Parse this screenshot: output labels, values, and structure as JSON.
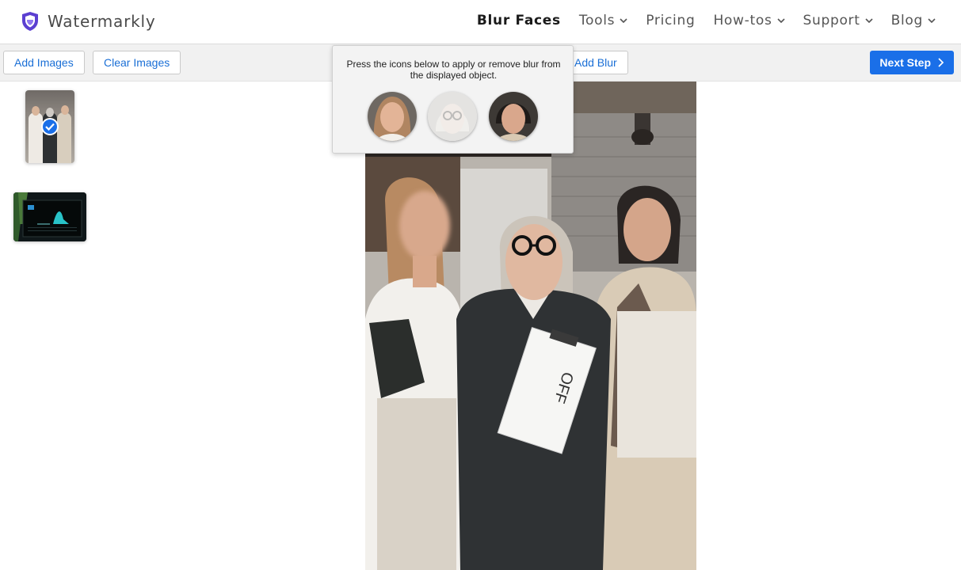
{
  "brand": {
    "name": "Watermarkly",
    "logo_icon": "shield-icon",
    "accent": "#5b3fd1"
  },
  "nav": [
    {
      "label": "Blur Faces",
      "active": true,
      "has_dropdown": false
    },
    {
      "label": "Tools",
      "active": false,
      "has_dropdown": true
    },
    {
      "label": "Pricing",
      "active": false,
      "has_dropdown": false
    },
    {
      "label": "How-tos",
      "active": false,
      "has_dropdown": true
    },
    {
      "label": "Support",
      "active": false,
      "has_dropdown": true
    },
    {
      "label": "Blog",
      "active": false,
      "has_dropdown": true
    }
  ],
  "toolbar": {
    "add_images": "Add Images",
    "clear_images": "Clear Images",
    "add_blur": "Add Blur",
    "next_step": "Next Step",
    "primary_color": "#1a6fe8"
  },
  "popover": {
    "message": "Press the icons below to apply or remove blur from the displayed object.",
    "faces": [
      {
        "name": "face-1",
        "blurred": false
      },
      {
        "name": "face-2",
        "blurred": true
      },
      {
        "name": "face-3",
        "blurred": false
      }
    ]
  },
  "sidebar": {
    "thumbnails": [
      {
        "name": "photo-three-women",
        "selected": true
      },
      {
        "name": "photo-dashboard",
        "selected": false
      }
    ]
  }
}
